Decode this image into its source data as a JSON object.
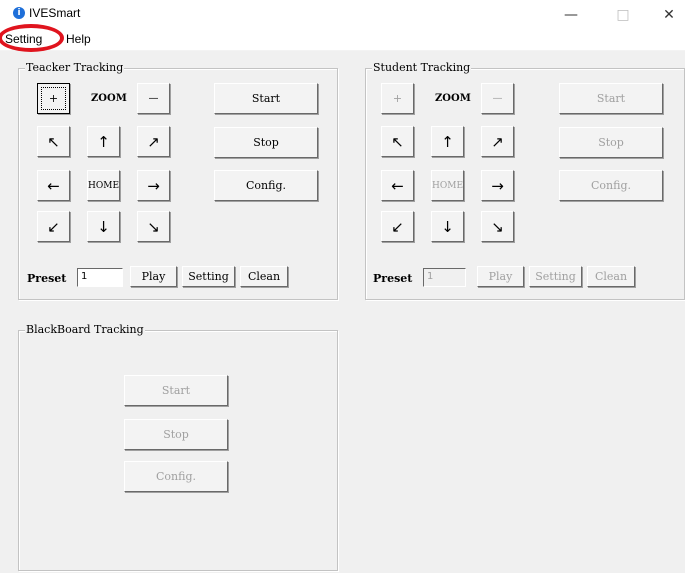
{
  "window": {
    "title": "IVESmart",
    "minimize": "—",
    "maximize": "□",
    "close": "✕"
  },
  "menu": [
    "Setting",
    "Help"
  ],
  "highlight_color": "#e0141e",
  "teacher": {
    "title": "Teacker Tracking",
    "zoom_in": "+",
    "zoom_label": "ZOOM",
    "zoom_out": "—",
    "up_left": "↖",
    "up": "↑",
    "up_right": "↗",
    "left": "←",
    "home": "HOME",
    "right": "→",
    "down_left": "↙",
    "down": "↓",
    "down_right": "↘",
    "start": "Start",
    "stop": "Stop",
    "config": "Config.",
    "preset_label": "Preset",
    "preset_value": "1",
    "play": "Play",
    "setting": "Setting",
    "clean": "Clean"
  },
  "student": {
    "title": "Student Tracking",
    "zoom_in": "+",
    "zoom_label": "ZOOM",
    "zoom_out": "—",
    "up_left": "↖",
    "up": "↑",
    "up_right": "↗",
    "left": "←",
    "home": "HOME",
    "right": "→",
    "down_left": "↙",
    "down": "↓",
    "down_right": "↘",
    "start": "Start",
    "stop": "Stop",
    "config": "Config.",
    "preset_label": "Preset",
    "preset_value": "1",
    "play": "Play",
    "setting": "Setting",
    "clean": "Clean"
  },
  "blackboard": {
    "title": "BlackBoard Tracking",
    "start": "Start",
    "stop": "Stop",
    "config": "Config."
  }
}
